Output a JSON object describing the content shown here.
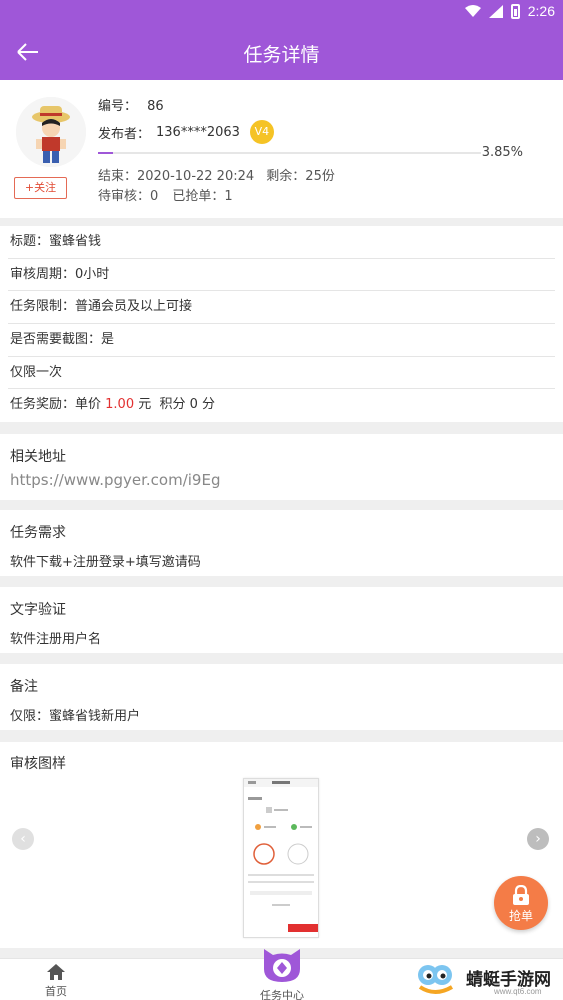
{
  "status_bar": {
    "time": "2:26"
  },
  "header": {
    "title": "任务详情"
  },
  "task": {
    "number_label": "编号：",
    "number": "86",
    "publisher_label": "发布者：",
    "publisher": "136****2063",
    "level": "V4",
    "progress_percent": 3.85,
    "progress_text": "3.85%",
    "end_text": "结束：2020-10-22 20:24",
    "remaining_text": "剩余：25份",
    "pending_text": "待审核：0",
    "grabbed_text": "已抢单：1",
    "follow_label": "+关注"
  },
  "details": {
    "title": "标题：蜜蜂省钱",
    "review_period": "审核周期：0小时",
    "restriction": "任务限制：普通会员及以上可接",
    "screenshot_required": "是否需要截图：是",
    "once_only": "仅限一次",
    "reward_prefix": "任务奖励：单价 ",
    "reward_price": "1.00",
    "reward_suffix": " 元  积分 0 分"
  },
  "sections": {
    "url_heading": "相关地址",
    "url_value": "https://www.pgyer.com/i9Eg",
    "requirement_heading": "任务需求",
    "requirement_value": "软件下载+注册登录+填写邀请码",
    "text_verify_heading": "文字验证",
    "text_verify_value": "软件注册用户名",
    "remark_heading": "备注",
    "remark_value": "仅限：蜜蜂省钱新用户",
    "review_image_heading": "审核图样"
  },
  "grab_button": {
    "label": "抢单"
  },
  "nav": {
    "home": "首页",
    "task_center": "任务中心"
  },
  "watermark": {
    "text": "蜻蜓手游网",
    "url": "www.qt6.com"
  },
  "colors": {
    "brand": "#9f57d8",
    "accent": "#f47c47",
    "price": "#e23030",
    "badge": "#f5c325"
  }
}
